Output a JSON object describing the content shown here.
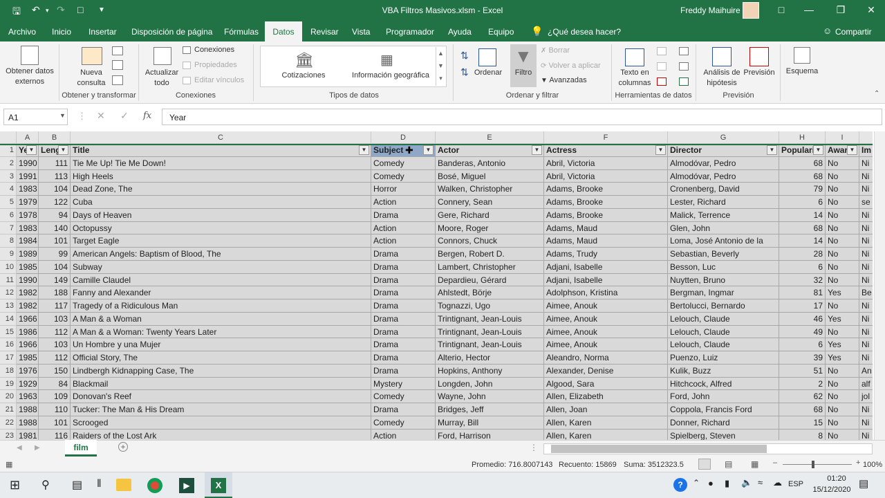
{
  "window": {
    "title": "VBA Filtros Masivos.xlsm  -  Excel",
    "user": "Freddy Maihuire"
  },
  "menu": {
    "tabs": [
      "Archivo",
      "Inicio",
      "Insertar",
      "Disposición de página",
      "Fórmulas",
      "Datos",
      "Revisar",
      "Vista",
      "Programador",
      "Ayuda",
      "Equipo"
    ],
    "tell_me": "¿Qué desea hacer?",
    "share": "Compartir",
    "active": "Datos"
  },
  "ribbon": {
    "get_external": "Obtener datos externos",
    "new_query": "Nueva consulta",
    "group_transform": "Obtener y transformar",
    "refresh_all": "Actualizar todo",
    "connections": "Conexiones",
    "properties": "Propiedades",
    "edit_links": "Editar vínculos",
    "group_connections": "Conexiones",
    "stocks": "Cotizaciones",
    "geo": "Información geográfica",
    "group_datatypes": "Tipos de datos",
    "sort": "Ordenar",
    "filter": "Filtro",
    "clear": "Borrar",
    "reapply": "Volver a aplicar",
    "advanced": "Avanzadas",
    "group_sortfilter": "Ordenar y filtrar",
    "text_to_cols": "Texto en columnas",
    "group_datatools": "Herramientas de datos",
    "whatif": "Análisis de hipótesis",
    "forecast": "Previsión",
    "group_forecast": "Previsión",
    "outline": "Esquema"
  },
  "formula_bar": {
    "name_box": "A1",
    "formula": "Year"
  },
  "columns": [
    "A",
    "B",
    "C",
    "D",
    "E",
    "F",
    "G",
    "H",
    "I"
  ],
  "headers": [
    "Ye",
    "Leng",
    "Title",
    "Subject",
    "Actor",
    "Actress",
    "Director",
    "Populari",
    "Awar",
    "Im"
  ],
  "rows": [
    [
      "1990",
      "111",
      "Tie Me Up! Tie Me Down!",
      "Comedy",
      "Banderas, Antonio",
      "Abril, Victoria",
      "Almodóvar, Pedro",
      "68",
      "No",
      "Ni"
    ],
    [
      "1991",
      "113",
      "High Heels",
      "Comedy",
      "Bosé, Miguel",
      "Abril, Victoria",
      "Almodóvar, Pedro",
      "68",
      "No",
      "Ni"
    ],
    [
      "1983",
      "104",
      "Dead Zone, The",
      "Horror",
      "Walken, Christopher",
      "Adams, Brooke",
      "Cronenberg, David",
      "79",
      "No",
      "Ni"
    ],
    [
      "1979",
      "122",
      "Cuba",
      "Action",
      "Connery, Sean",
      "Adams, Brooke",
      "Lester, Richard",
      "6",
      "No",
      "se"
    ],
    [
      "1978",
      "94",
      "Days of Heaven",
      "Drama",
      "Gere, Richard",
      "Adams, Brooke",
      "Malick, Terrence",
      "14",
      "No",
      "Ni"
    ],
    [
      "1983",
      "140",
      "Octopussy",
      "Action",
      "Moore, Roger",
      "Adams, Maud",
      "Glen, John",
      "68",
      "No",
      "Ni"
    ],
    [
      "1984",
      "101",
      "Target Eagle",
      "Action",
      "Connors, Chuck",
      "Adams, Maud",
      "Loma, José Antonio de la",
      "14",
      "No",
      "Ni"
    ],
    [
      "1989",
      "99",
      "American Angels: Baptism of Blood, The",
      "Drama",
      "Bergen, Robert D.",
      "Adams, Trudy",
      "Sebastian, Beverly",
      "28",
      "No",
      "Ni"
    ],
    [
      "1985",
      "104",
      "Subway",
      "Drama",
      "Lambert, Christopher",
      "Adjani, Isabelle",
      "Besson, Luc",
      "6",
      "No",
      "Ni"
    ],
    [
      "1990",
      "149",
      "Camille Claudel",
      "Drama",
      "Depardieu, Gérard",
      "Adjani, Isabelle",
      "Nuytten, Bruno",
      "32",
      "No",
      "Ni"
    ],
    [
      "1982",
      "188",
      "Fanny and Alexander",
      "Drama",
      "Ahlstedt, Börje",
      "Adolphson, Kristina",
      "Bergman, Ingmar",
      "81",
      "Yes",
      "Be"
    ],
    [
      "1982",
      "117",
      "Tragedy of a Ridiculous Man",
      "Drama",
      "Tognazzi, Ugo",
      "Aimee, Anouk",
      "Bertolucci, Bernardo",
      "17",
      "No",
      "Ni"
    ],
    [
      "1966",
      "103",
      "A Man & a Woman",
      "Drama",
      "Trintignant, Jean-Louis",
      "Aimee, Anouk",
      "Lelouch, Claude",
      "46",
      "Yes",
      "Ni"
    ],
    [
      "1986",
      "112",
      "A Man & a Woman: Twenty Years Later",
      "Drama",
      "Trintignant, Jean-Louis",
      "Aimee, Anouk",
      "Lelouch, Claude",
      "49",
      "No",
      "Ni"
    ],
    [
      "1966",
      "103",
      "Un Hombre y una Mujer",
      "Drama",
      "Trintignant, Jean-Louis",
      "Aimee, Anouk",
      "Lelouch, Claude",
      "6",
      "Yes",
      "Ni"
    ],
    [
      "1985",
      "112",
      "Official Story, The",
      "Drama",
      "Alterio, Hector",
      "Aleandro, Norma",
      "Puenzo, Luiz",
      "39",
      "Yes",
      "Ni"
    ],
    [
      "1976",
      "150",
      "Lindbergh Kidnapping Case, The",
      "Drama",
      "Hopkins, Anthony",
      "Alexander, Denise",
      "Kulik, Buzz",
      "51",
      "No",
      "An"
    ],
    [
      "1929",
      "84",
      "Blackmail",
      "Mystery",
      "Longden, John",
      "Algood, Sara",
      "Hitchcock, Alfred",
      "2",
      "No",
      "alf"
    ],
    [
      "1963",
      "109",
      "Donovan's Reef",
      "Comedy",
      "Wayne, John",
      "Allen, Elizabeth",
      "Ford, John",
      "62",
      "No",
      "jol"
    ],
    [
      "1988",
      "110",
      "Tucker: The Man & His Dream",
      "Drama",
      "Bridges, Jeff",
      "Allen, Joan",
      "Coppola, Francis Ford",
      "68",
      "No",
      "Ni"
    ],
    [
      "1988",
      "101",
      "Scrooged",
      "Comedy",
      "Murray, Bill",
      "Allen, Karen",
      "Donner, Richard",
      "15",
      "No",
      "Ni"
    ],
    [
      "1981",
      "116",
      "Raiders of the Lost Ark",
      "Action",
      "Ford, Harrison",
      "Allen, Karen",
      "Spielberg, Steven",
      "8",
      "No",
      "Ni"
    ]
  ],
  "row_numbers": [
    "1",
    "2",
    "3",
    "4",
    "5",
    "6",
    "7",
    "8",
    "9",
    "10",
    "11",
    "12",
    "13",
    "14",
    "15",
    "16",
    "17",
    "18",
    "19",
    "20",
    "21",
    "22",
    "23"
  ],
  "sheet": {
    "tab": "film"
  },
  "status": {
    "average": "Promedio: 716.8007143",
    "count": "Recuento: 15869",
    "sum": "Suma: 3512323.5",
    "zoom": "100%"
  },
  "taskbar": {
    "lang": "ESP",
    "time": "01:20",
    "date": "15/12/2020"
  }
}
